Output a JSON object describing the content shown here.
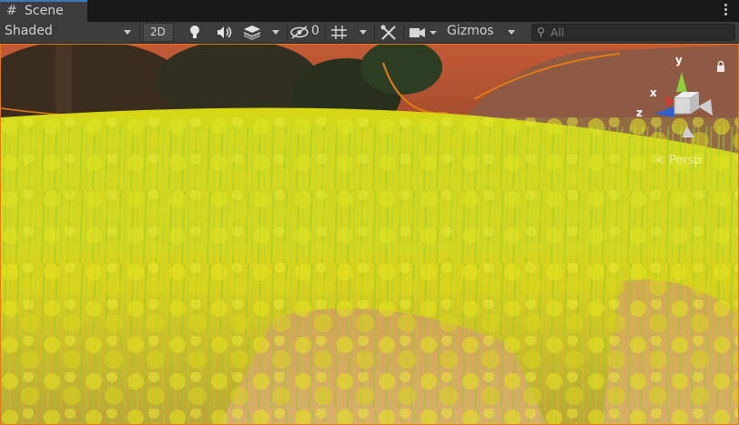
{
  "tab": {
    "title": "Scene"
  },
  "toolbar": {
    "shading_mode": "Shaded",
    "mode_2d": "2D",
    "hidden_count": "0",
    "gizmos_label": "Gizmos",
    "search_placeholder": "All"
  },
  "viewport": {
    "projection_label": "< Persp",
    "axis_labels": {
      "y": "y",
      "x": "x",
      "z": "z"
    }
  },
  "colors": {
    "accent": "#3a79bb",
    "selection_outline": "#e47a15",
    "toolbar_bg": "#3c3c3c",
    "axis_y": "#8ccf3b",
    "axis_x": "#d33a2f",
    "axis_z": "#2f5fd0"
  },
  "icons": [
    "scene-tab-icon",
    "more-menu-icon",
    "light-bulb-icon",
    "audio-icon",
    "effects-icon",
    "visibility-icon",
    "grid-icon",
    "tools-icon",
    "camera-icon",
    "search-icon",
    "lock-icon"
  ]
}
